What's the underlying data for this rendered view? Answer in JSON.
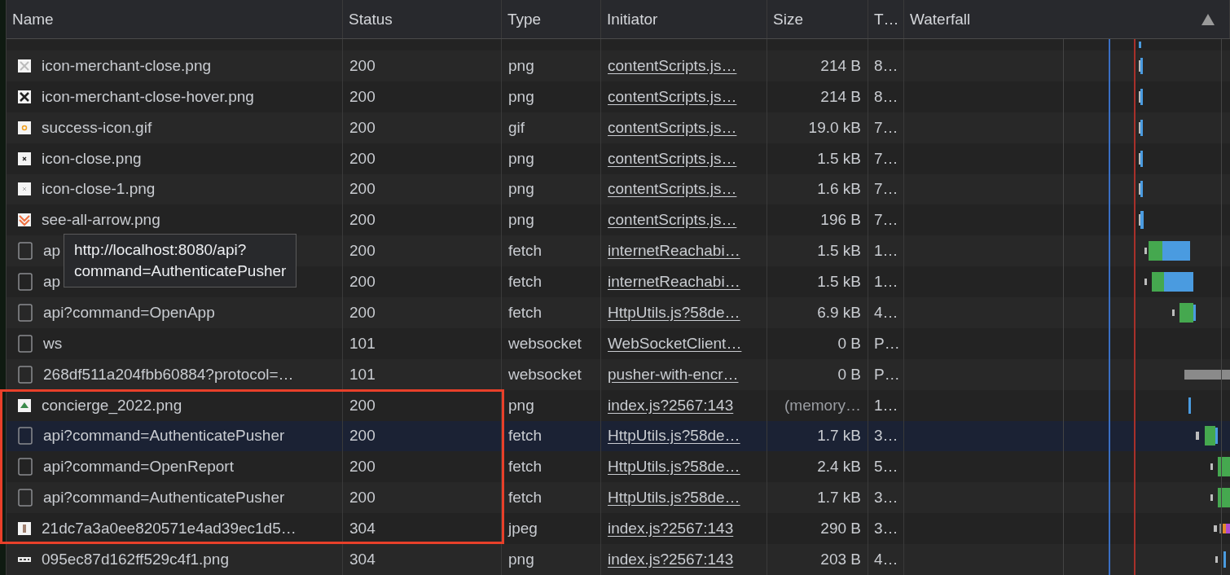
{
  "columns": [
    {
      "label": "Name"
    },
    {
      "label": "Status"
    },
    {
      "label": "Type"
    },
    {
      "label": "Initiator"
    },
    {
      "label": "Size"
    },
    {
      "label": "T…"
    },
    {
      "label": "Waterfall"
    }
  ],
  "rows": [
    {
      "kind": "image",
      "name": "icon-merchant-close.png",
      "status": "200",
      "type": "png",
      "initiator": "contentScripts.js…",
      "size": "214 B",
      "time": "8…",
      "selected": false,
      "cached": false,
      "annotated": false
    },
    {
      "kind": "image",
      "name": "icon-merchant-close-hover.png",
      "status": "200",
      "type": "png",
      "initiator": "contentScripts.js…",
      "size": "214 B",
      "time": "8…",
      "selected": false,
      "cached": false,
      "annotated": false
    },
    {
      "kind": "image",
      "name": "success-icon.gif",
      "status": "200",
      "type": "gif",
      "initiator": "contentScripts.js…",
      "size": "19.0 kB",
      "time": "7…",
      "selected": false,
      "cached": false,
      "annotated": false
    },
    {
      "kind": "image",
      "name": "icon-close.png",
      "status": "200",
      "type": "png",
      "initiator": "contentScripts.js…",
      "size": "1.5 kB",
      "time": "7…",
      "selected": false,
      "cached": false,
      "annotated": false
    },
    {
      "kind": "image",
      "name": "icon-close-1.png",
      "status": "200",
      "type": "png",
      "initiator": "contentScripts.js…",
      "size": "1.6 kB",
      "time": "7…",
      "selected": false,
      "cached": false,
      "annotated": false
    },
    {
      "kind": "image",
      "name": "see-all-arrow.png",
      "status": "200",
      "type": "png",
      "initiator": "contentScripts.js…",
      "size": "196 B",
      "time": "7…",
      "selected": false,
      "cached": false,
      "annotated": false
    },
    {
      "kind": "request",
      "name": "ap",
      "status": "200",
      "type": "fetch",
      "initiator": "internetReachabi…",
      "size": "1.5 kB",
      "time": "1…",
      "selected": false,
      "cached": false,
      "annotated": false
    },
    {
      "kind": "request",
      "name": "ap",
      "status": "200",
      "type": "fetch",
      "initiator": "internetReachabi…",
      "size": "1.5 kB",
      "time": "1…",
      "selected": false,
      "cached": false,
      "annotated": false
    },
    {
      "kind": "request",
      "name": "api?command=OpenApp",
      "status": "200",
      "type": "fetch",
      "initiator": "HttpUtils.js?58de…",
      "size": "6.9 kB",
      "time": "4…",
      "selected": false,
      "cached": false,
      "annotated": false
    },
    {
      "kind": "request",
      "name": "ws",
      "status": "101",
      "type": "websocket",
      "initiator": "WebSocketClient…",
      "size": "0 B",
      "time": "P…",
      "selected": false,
      "cached": false,
      "annotated": false
    },
    {
      "kind": "request",
      "name": "268df511a204fbb60884?protocol=…",
      "status": "101",
      "type": "websocket",
      "initiator": "pusher-with-encr…",
      "size": "0 B",
      "time": "P…",
      "selected": false,
      "cached": false,
      "annotated": false
    },
    {
      "kind": "image",
      "name": "concierge_2022.png",
      "status": "200",
      "type": "png",
      "initiator": "index.js?2567:143",
      "size": "(memory…",
      "time": "1…",
      "selected": false,
      "cached": true,
      "annotated": true
    },
    {
      "kind": "request",
      "name": "api?command=AuthenticatePusher",
      "status": "200",
      "type": "fetch",
      "initiator": "HttpUtils.js?58de…",
      "size": "1.7 kB",
      "time": "3…",
      "selected": true,
      "cached": false,
      "annotated": true
    },
    {
      "kind": "request",
      "name": "api?command=OpenReport",
      "status": "200",
      "type": "fetch",
      "initiator": "HttpUtils.js?58de…",
      "size": "2.4 kB",
      "time": "5…",
      "selected": false,
      "cached": false,
      "annotated": true
    },
    {
      "kind": "request",
      "name": "api?command=AuthenticatePusher",
      "status": "200",
      "type": "fetch",
      "initiator": "HttpUtils.js?58de…",
      "size": "1.7 kB",
      "time": "3…",
      "selected": false,
      "cached": false,
      "annotated": true
    },
    {
      "kind": "image",
      "name": "21dc7a3a0ee820571e4ad39ec1d5…",
      "status": "304",
      "type": "jpeg",
      "initiator": "index.js?2567:143",
      "size": "290 B",
      "time": "3…",
      "selected": false,
      "cached": false,
      "annotated": true
    },
    {
      "kind": "image",
      "name": "095ec87d162ff529c4f1.png",
      "status": "304",
      "type": "png",
      "initiator": "index.js?2567:143",
      "size": "203 B",
      "time": "4…",
      "selected": false,
      "cached": false,
      "annotated": false
    }
  ],
  "tooltip": {
    "lines": [
      "http://localhost:8080/api?",
      "command=AuthenticatePusher"
    ]
  }
}
